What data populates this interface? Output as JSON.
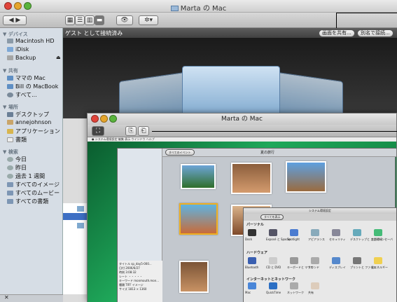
{
  "window": {
    "title": "Marta の Mac"
  },
  "toolbar": {
    "search_placeholder": "",
    "action_label": "✲▾"
  },
  "pathbar": {
    "status": "ゲスト として接続済み",
    "share_screen": "画面を共有...",
    "connect_as": "別名で接続..."
  },
  "sidebar": {
    "devices_header": "▼ デバイス",
    "devices": [
      "Macintosh HD",
      "iDisk",
      "Backup"
    ],
    "shared_header": "▼ 共有",
    "shared": [
      "ママの Mac",
      "Bill の MacBook",
      "すべて..."
    ],
    "places_header": "▼ 場所",
    "places": [
      "デスクトップ",
      "annejohnson",
      "アプリケーション",
      "書類"
    ],
    "search_header": "▼ 検索",
    "search": [
      "今日",
      "昨日",
      "過去 1 週間",
      "すべてのイメージ",
      "すべてのムービー",
      "すべての書類"
    ]
  },
  "inner": {
    "title": "Marta の Mac",
    "iphoto_title": "夏の旅行",
    "iphoto_back": "すべてのイベント",
    "info_lines": [
      "タイトル sp_day5-000...",
      "日付 2006/6/27",
      "時刻 3:08:32",
      "レート ・・・・・",
      "キーワード monmouth.mon...",
      "種類 TIFF イメージ",
      "サイズ 1813 × 1360"
    ],
    "prefs_title": "システム環境設定",
    "prefs_show_all": "すべてを表示",
    "prefs_personal": "パーソナル",
    "prefs_hardware": "ハードウェア",
    "prefs_internet": "インターネットとネットワーク",
    "prefs_personal_items": [
      "Dock",
      "Exposé と Spaces",
      "Spotlight",
      "アピアランス",
      "セキュリティ",
      "デスクトップと スクリーンセーバ",
      "言語環境"
    ],
    "prefs_hardware_items": [
      "Bluetooth",
      "CD と DVD",
      "キーボードと マウス",
      "サウンド",
      "ディスプレイ",
      "プリントと ファクス",
      "省エネルギー"
    ],
    "prefs_internet_items": [
      "Mac",
      "QuickTime",
      "ネットワーク",
      "共有"
    ]
  }
}
